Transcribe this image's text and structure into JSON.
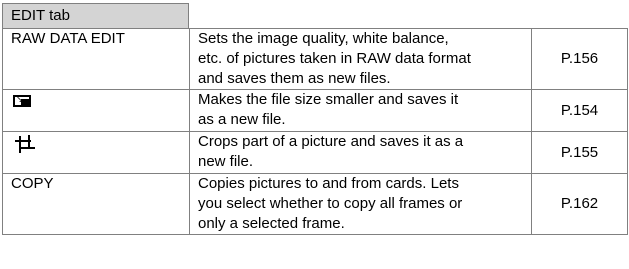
{
  "tab": {
    "label": "EDIT tab"
  },
  "rows": [
    {
      "name": "RAW DATA EDIT",
      "icon": null,
      "description": "Sets the image quality, white balance, etc. of pictures taken in RAW data format and saves them as new files.",
      "desc_lines": [
        "Sets the image quality, white balance,",
        "etc. of pictures taken in RAW data format",
        "and saves them as new files."
      ],
      "page": "P.156"
    },
    {
      "name": "",
      "icon": "resize-icon",
      "description": "Makes the file size smaller and saves it as a new file.",
      "desc_lines": [
        "Makes the file size smaller and saves it",
        "as a new file."
      ],
      "page": "P.154"
    },
    {
      "name": "",
      "icon": "crop-icon",
      "description": "Crops part of a picture and saves it as a new file.",
      "desc_lines": [
        "Crops part of a picture and saves it as a",
        "new file."
      ],
      "page": "P.155"
    },
    {
      "name": "COPY",
      "icon": null,
      "description": "Copies pictures to and from cards. Lets you select whether to copy all frames or only a selected frame.",
      "desc_lines": [
        "Copies pictures to and from cards. Lets",
        "you select whether to copy all frames or",
        "only a selected frame."
      ],
      "page": "P.162"
    }
  ]
}
